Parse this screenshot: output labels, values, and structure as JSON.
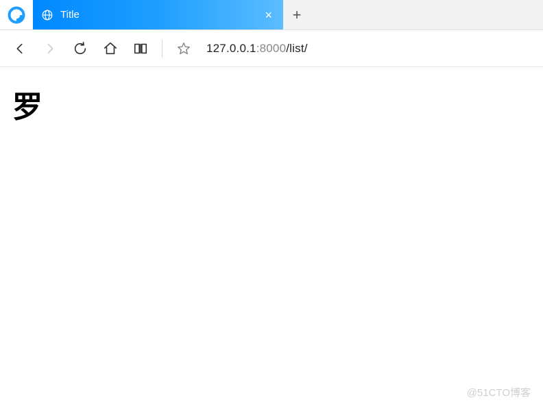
{
  "tab": {
    "title": "Title",
    "close_symbol": "×"
  },
  "new_tab_symbol": "+",
  "address": {
    "host": "127.0.0.1",
    "port": ":8000",
    "path": "/list/"
  },
  "page": {
    "heading": "罗"
  },
  "watermark": "@51CTO博客"
}
